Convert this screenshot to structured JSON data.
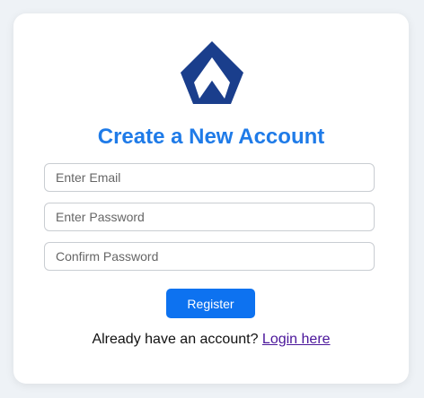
{
  "logo": {
    "icon": "diamond-arrow-logo",
    "color": "#1a3e8c"
  },
  "title": "Create a New Account",
  "form": {
    "email_placeholder": "Enter Email",
    "password_placeholder": "Enter Password",
    "confirm_placeholder": "Confirm Password",
    "register_label": "Register"
  },
  "footer": {
    "prompt": "Already have an account?",
    "link_label": "Login here"
  },
  "colors": {
    "accent": "#1f7be8",
    "button": "#0d72f0",
    "link": "#4a159a"
  }
}
